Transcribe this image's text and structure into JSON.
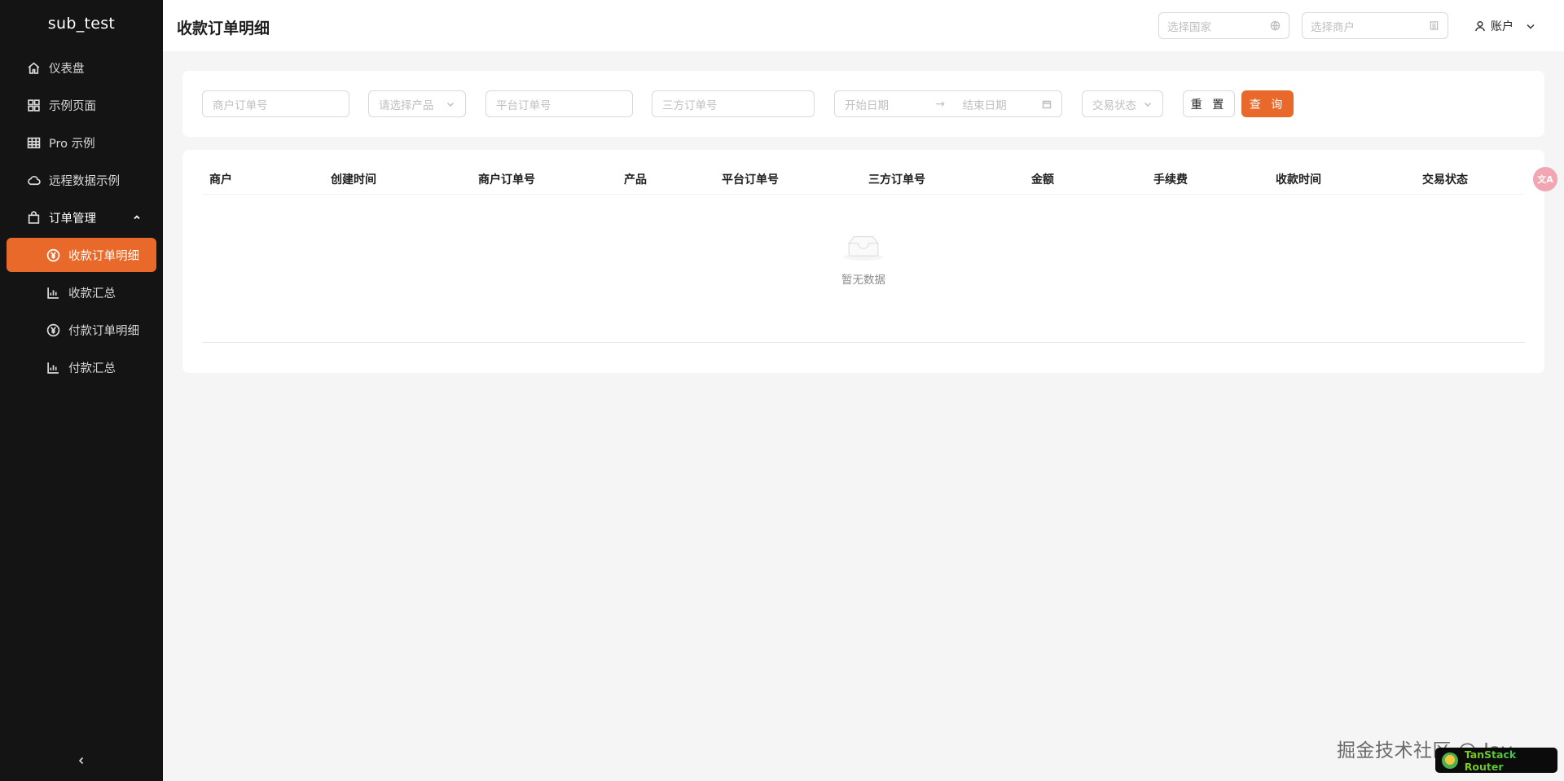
{
  "app": {
    "brand": "sub_test"
  },
  "sidebar": {
    "items": [
      {
        "label": "仪表盘",
        "icon": "home-icon"
      },
      {
        "label": "示例页面",
        "icon": "grid-icon"
      },
      {
        "label": "Pro 示例",
        "icon": "table-icon"
      },
      {
        "label": "远程数据示例",
        "icon": "cloud-icon"
      }
    ],
    "group": {
      "label": "订单管理",
      "icon": "shopping-bag-icon",
      "expanded": true,
      "children": [
        {
          "label": "收款订单明细",
          "icon": "yen-circle-icon",
          "active": true
        },
        {
          "label": "收款汇总",
          "icon": "bar-chart-icon"
        },
        {
          "label": "付款订单明细",
          "icon": "yen-circle-icon"
        },
        {
          "label": "付款汇总",
          "icon": "bar-chart-icon"
        }
      ]
    },
    "collapse_icon": "chevron-left-icon"
  },
  "header": {
    "title": "收款订单明细",
    "country_placeholder": "选择国家",
    "merchant_placeholder": "选择商户",
    "account_label": "账户"
  },
  "filters": {
    "merchant_order_placeholder": "商户订单号",
    "product_placeholder": "请选择产品",
    "platform_order_placeholder": "平台订单号",
    "third_party_order_placeholder": "三方订单号",
    "start_date_placeholder": "开始日期",
    "end_date_placeholder": "结束日期",
    "range_separator": "→",
    "status_placeholder": "交易状态",
    "reset_label": "重 置",
    "query_label": "查 询"
  },
  "table": {
    "columns": [
      "商户",
      "创建时间",
      "商户订单号",
      "产品",
      "平台订单号",
      "三方订单号",
      "金额",
      "手续费",
      "收款时间",
      "交易状态"
    ],
    "rows": [],
    "empty_text": "暂无数据"
  },
  "float": {
    "translate_label": "文A"
  },
  "watermark": "掘金技术社区 @ Jay",
  "devtools": {
    "label": "TanStack Router"
  },
  "colors": {
    "accent": "#e8692a",
    "sidebar_bg": "#141414",
    "page_bg": "#f5f5f5"
  }
}
